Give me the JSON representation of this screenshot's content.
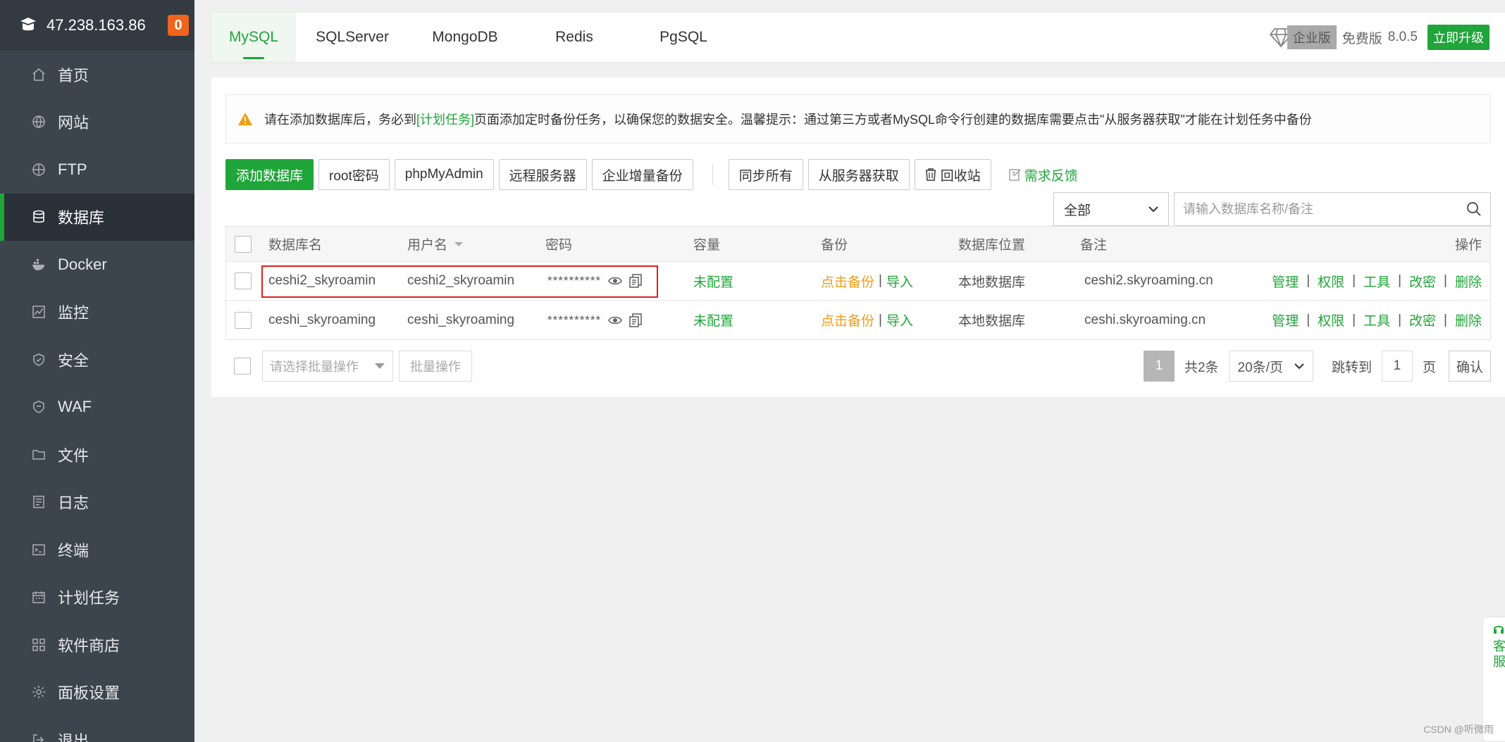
{
  "sidebar": {
    "server_ip": "47.238.163.86",
    "badge": "0",
    "items": [
      {
        "label": "首页",
        "icon": "home-icon"
      },
      {
        "label": "网站",
        "icon": "globe-icon"
      },
      {
        "label": "FTP",
        "icon": "ftp-icon"
      },
      {
        "label": "数据库",
        "icon": "database-icon",
        "active": true
      },
      {
        "label": "Docker",
        "icon": "docker-icon"
      },
      {
        "label": "监控",
        "icon": "monitor-icon"
      },
      {
        "label": "安全",
        "icon": "shield-icon"
      },
      {
        "label": "WAF",
        "icon": "waf-icon"
      },
      {
        "label": "文件",
        "icon": "folder-icon"
      },
      {
        "label": "日志",
        "icon": "log-icon"
      },
      {
        "label": "终端",
        "icon": "terminal-icon"
      },
      {
        "label": "计划任务",
        "icon": "calendar-icon"
      },
      {
        "label": "软件商店",
        "icon": "apps-icon"
      },
      {
        "label": "面板设置",
        "icon": "gear-icon"
      },
      {
        "label": "退出",
        "icon": "logout-icon"
      }
    ]
  },
  "tabs": [
    "MySQL",
    "SQLServer",
    "MongoDB",
    "Redis",
    "PgSQL"
  ],
  "version": {
    "enterprise": "企业版",
    "free": "免费版",
    "number": "8.0.5",
    "upgrade": "立即升级"
  },
  "alert": {
    "before": "请在添加数据库后，务必到",
    "link": "[计划任务]",
    "after": "页面添加定时备份任务，以确保您的数据安全。温馨提示：通过第三方或者MySQL命令行创建的数据库需要点击\"从服务器获取\"才能在计划任务中备份"
  },
  "toolbar": {
    "add": "添加数据库",
    "root_pwd": "root密码",
    "phpmyadmin": "phpMyAdmin",
    "remote": "远程服务器",
    "enterprise_backup": "企业增量备份",
    "sync_all": "同步所有",
    "fetch": "从服务器获取",
    "recycle": "回收站",
    "feedback": "需求反馈"
  },
  "filter": {
    "select": "全部",
    "placeholder": "请输入数据库名称/备注"
  },
  "table": {
    "headers": {
      "name": "数据库名",
      "user": "用户名",
      "password": "密码",
      "capacity": "容量",
      "backup": "备份",
      "location": "数据库位置",
      "note": "备注",
      "ops": "操作"
    },
    "rows": [
      {
        "name": "ceshi2_skyroamin",
        "user": "ceshi2_skyroamin",
        "password": "**********",
        "capacity": "未配置",
        "backup": "点击备份",
        "import": "导入",
        "location": "本地数据库",
        "note": "ceshi2.skyroaming.cn"
      },
      {
        "name": "ceshi_skyroaming",
        "user": "ceshi_skyroaming",
        "password": "**********",
        "capacity": "未配置",
        "backup": "点击备份",
        "import": "导入",
        "location": "本地数据库",
        "note": "ceshi.skyroaming.cn"
      }
    ],
    "ops": [
      "管理",
      "权限",
      "工具",
      "改密",
      "删除"
    ]
  },
  "bulk": {
    "placeholder": "请选择批量操作",
    "button": "批量操作"
  },
  "pager": {
    "current": "1",
    "total": "共2条",
    "size": "20条/页",
    "jump": "跳转到",
    "page_input": "1",
    "page_unit": "页",
    "confirm": "确认"
  },
  "float": {
    "line1": "客",
    "line2": "服"
  },
  "watermark": "CSDN @听微雨",
  "colors": {
    "accent": "#20a53a",
    "sidebar": "#3c444d",
    "warning": "#f39c12",
    "highlight": "#e02020"
  }
}
